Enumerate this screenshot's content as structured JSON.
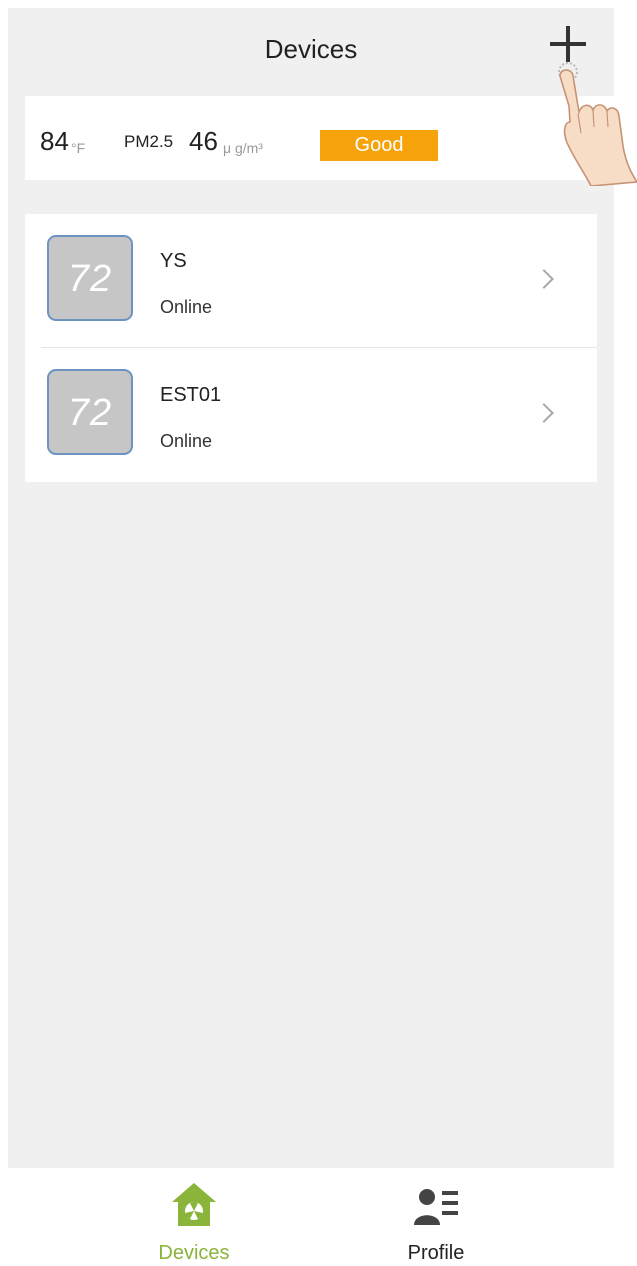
{
  "header": {
    "title": "Devices",
    "add_icon": "plus-icon"
  },
  "weather": {
    "temperature": "84",
    "temperature_unit": "°F",
    "pm_label": "PM2.5",
    "pm_value": "46",
    "pm_unit": "μ g/m³",
    "air_quality": "Good",
    "air_quality_color": "#f5a20b"
  },
  "devices": [
    {
      "thumb_text": "72",
      "name": "YS",
      "status": "Online"
    },
    {
      "thumb_text": "72",
      "name": "EST01",
      "status": "Online"
    }
  ],
  "tabbar": {
    "tabs": [
      {
        "label": "Devices",
        "icon": "home-icon",
        "active": true,
        "color": "#8ab43a"
      },
      {
        "label": "Profile",
        "icon": "profile-icon",
        "active": false,
        "color": "#333333"
      }
    ]
  },
  "overlay": {
    "icon": "tap-hand-icon"
  }
}
